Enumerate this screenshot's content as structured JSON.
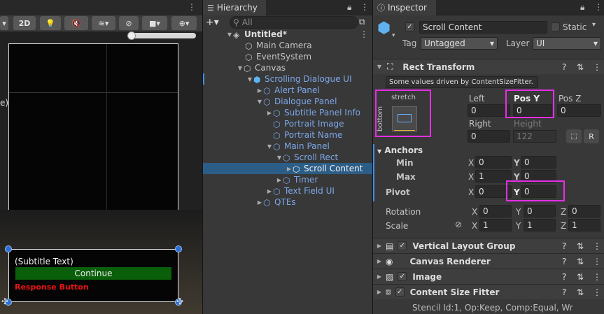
{
  "scene": {
    "toolbar": {
      "mode_2d": "2D"
    },
    "game_view": {
      "subtitle": "(Subtitle Text)",
      "continue_label": "Continue",
      "response_label": "Response Button",
      "left_edge_text": "e)"
    }
  },
  "hierarchy": {
    "tab": "Hierarchy",
    "search_placeholder": "All",
    "items": [
      {
        "label": "Untitled*"
      },
      {
        "label": "Main Camera"
      },
      {
        "label": "EventSystem"
      },
      {
        "label": "Canvas"
      },
      {
        "label": "Scrolling Dialogue UI"
      },
      {
        "label": "Alert Panel"
      },
      {
        "label": "Dialogue Panel"
      },
      {
        "label": "Subtitle Panel Info"
      },
      {
        "label": "Portrait Image"
      },
      {
        "label": "Portrait Name"
      },
      {
        "label": "Main Panel"
      },
      {
        "label": "Scroll Rect"
      },
      {
        "label": "Scroll Content"
      },
      {
        "label": "Timer"
      },
      {
        "label": "Text Field UI"
      },
      {
        "label": "QTEs"
      }
    ]
  },
  "inspector": {
    "tab": "Inspector",
    "object_name": "Scroll Content",
    "static_label": "Static",
    "tag_label": "Tag",
    "tag_value": "Untagged",
    "layer_label": "Layer",
    "layer_value": "UI",
    "rect_transform": {
      "title": "Rect Transform",
      "note": "Some values driven by ContentSizeFitter.",
      "anchor_h": "stretch",
      "anchor_v": "bottom",
      "left_label": "Left",
      "left": "0",
      "posy_label": "Pos Y",
      "posy": "0",
      "posz_label": "Pos Z",
      "posz": "0",
      "right_label": "Right",
      "right": "0",
      "height_label": "Height",
      "height": "122",
      "raw_btn": "R",
      "anchors_label": "Anchors",
      "min_label": "Min",
      "min_x": "0",
      "min_y": "0",
      "max_label": "Max",
      "max_x": "1",
      "max_y": "0",
      "pivot_label": "Pivot",
      "pivot_x": "0",
      "pivot_y": "0",
      "rotation_label": "Rotation",
      "rot_x": "0",
      "rot_y": "0",
      "rot_z": "0",
      "scale_label": "Scale",
      "scale_x": "1",
      "scale_y": "1",
      "scale_z": "1",
      "x": "X",
      "y": "Y",
      "z": "Z"
    },
    "components": [
      {
        "label": "Vertical Layout Group"
      },
      {
        "label": "Canvas Renderer"
      },
      {
        "label": "Image"
      },
      {
        "label": "Content Size Fitter"
      }
    ],
    "footer": "Stencil Id:1, Op:Keep, Comp:Equal, Wr"
  }
}
